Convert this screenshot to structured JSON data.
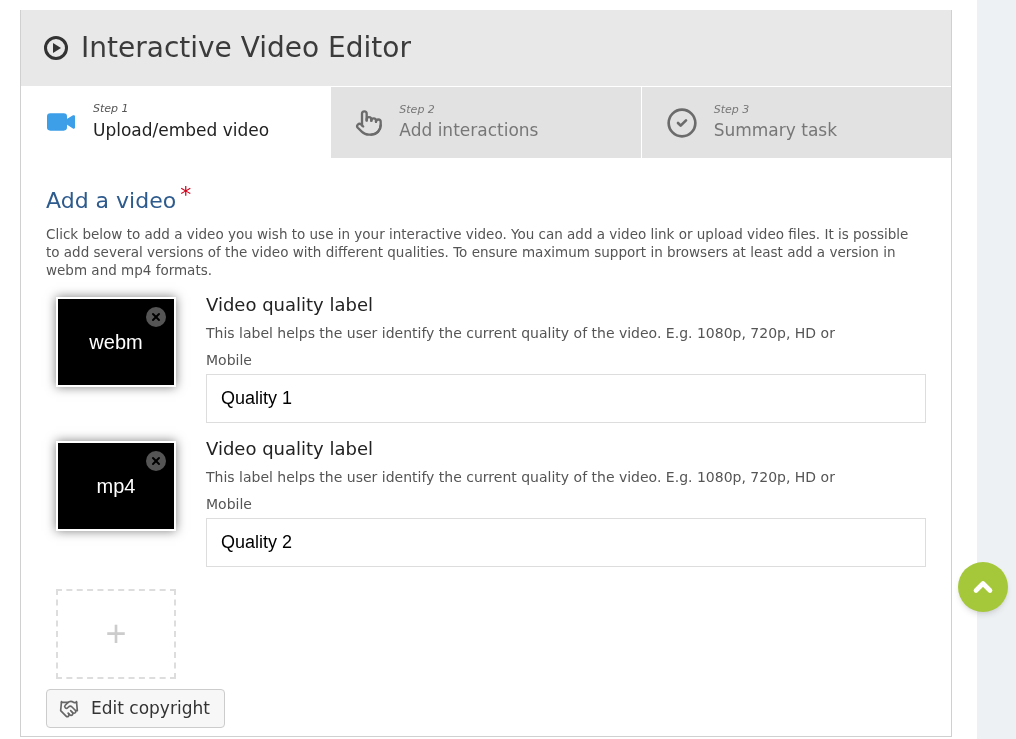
{
  "window": {
    "title": "Interactive Video Editor"
  },
  "steps": [
    {
      "step": "Step 1",
      "label": "Upload/embed video",
      "kind": "video",
      "selected": true
    },
    {
      "step": "Step 2",
      "label": "Add interactions",
      "kind": "touch",
      "selected": false
    },
    {
      "step": "Step 3",
      "label": "Summary task",
      "kind": "check",
      "selected": false
    }
  ],
  "section": {
    "title": "Add a video",
    "required_mark": "*",
    "description": "Click below to add a video you wish to use in your interactive video. You can add a video link or upload video files. It is possible to add several versions of the video with different qualities. To ensure maximum support in browsers at least add a version in webm and mp4 formats."
  },
  "videos": [
    {
      "format": "webm",
      "field_label": "Video quality label",
      "help": "This label helps the user identify the current quality of the video. E.g. 1080p, 720p, HD or Mobile",
      "value": "Quality 1"
    },
    {
      "format": "mp4",
      "field_label": "Video quality label",
      "help": "This label helps the user identify the current quality of the video. E.g. 1080p, 720p, HD or Mobile",
      "value": "Quality 2"
    }
  ],
  "add_button": {
    "label": "+"
  },
  "copyright_button": {
    "label": "Edit copyright"
  }
}
